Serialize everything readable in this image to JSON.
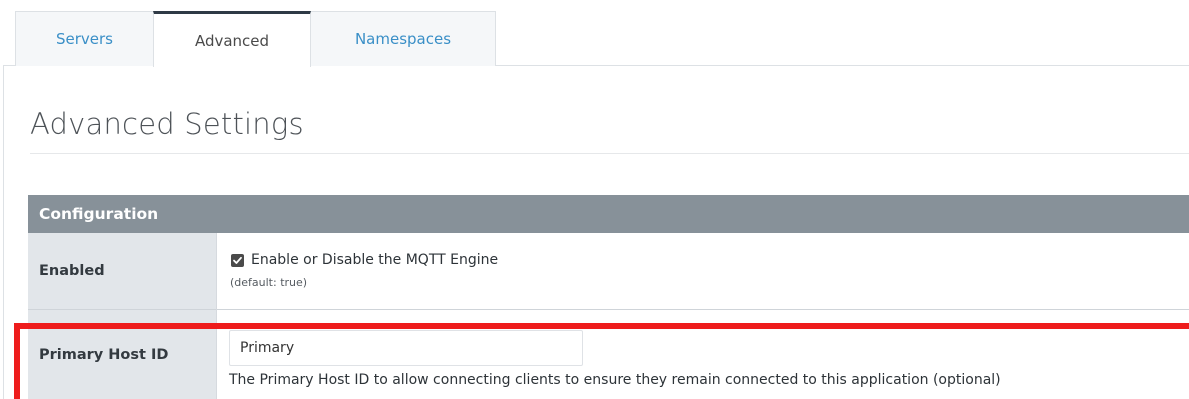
{
  "tabs": [
    {
      "label": "Servers",
      "active": false
    },
    {
      "label": "Advanced",
      "active": true
    },
    {
      "label": "Namespaces",
      "active": false
    }
  ],
  "page": {
    "title": "Advanced Settings"
  },
  "config": {
    "header": "Configuration",
    "rows": {
      "enabled": {
        "label": "Enabled",
        "checkbox_label": "Enable or Disable the MQTT Engine",
        "checked": true,
        "default_note": "(default: true)"
      },
      "primary_host": {
        "label": "Primary Host ID",
        "value": "Primary",
        "help": "The Primary Host ID to allow connecting clients to ensure they remain connected to this application (optional)"
      }
    }
  },
  "colors": {
    "tab_link": "#3a8fc7",
    "header_bg": "#879199",
    "label_bg": "#e2e6ea",
    "highlight": "#ee1c1c"
  }
}
